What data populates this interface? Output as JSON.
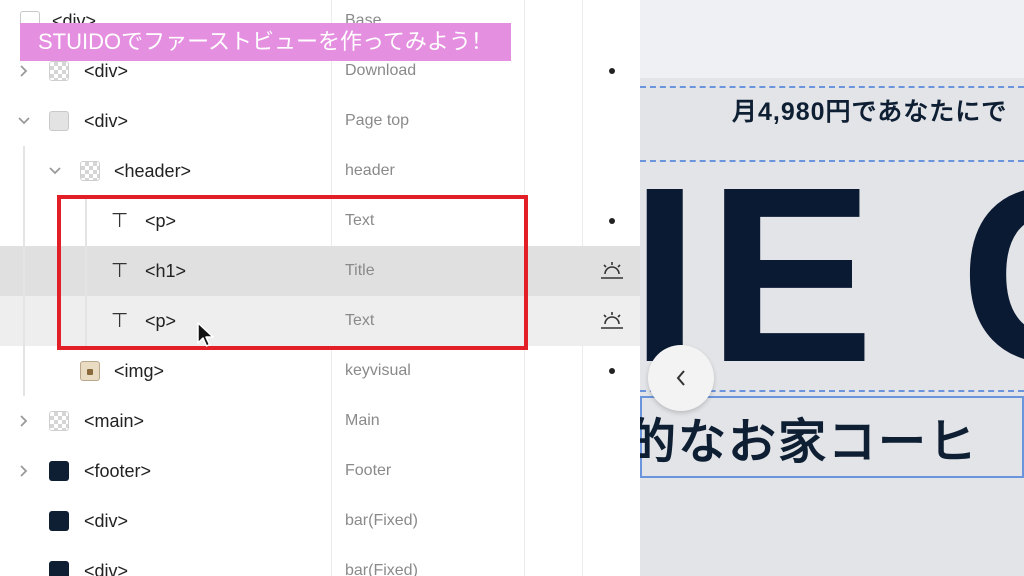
{
  "caption": "STUIDOでファーストビューを作ってみよう！",
  "layers": [
    {
      "tag": "<div>",
      "name": "Base",
      "icon": "square-outline-icon"
    },
    {
      "tag": "<div>",
      "name": "Download",
      "icon": "checker-box-icon"
    },
    {
      "tag": "<div>",
      "name": "Page top",
      "icon": "gray-box-icon"
    },
    {
      "tag": "<header>",
      "name": "header",
      "icon": "checker-box-icon"
    },
    {
      "tag": "<p>",
      "name": "Text",
      "icon": "text-icon"
    },
    {
      "tag": "<h1>",
      "name": "Title",
      "icon": "text-icon",
      "state": "selected"
    },
    {
      "tag": "<p>",
      "name": "Text",
      "icon": "text-icon",
      "state": "hover"
    },
    {
      "tag": "<img>",
      "name": "keyvisual",
      "icon": "image-icon"
    },
    {
      "tag": "<main>",
      "name": "Main",
      "icon": "checker-box-icon"
    },
    {
      "tag": "<footer>",
      "name": "Footer",
      "icon": "navy-box-icon"
    },
    {
      "tag": "<div>",
      "name": "bar(Fixed)",
      "icon": "navy-box-icon"
    },
    {
      "tag": "<div>",
      "name": "bar(Fixed)",
      "icon": "navy-box-icon"
    }
  ],
  "text_icon_glyph": "⊤",
  "preview": {
    "offer": "月4,980円であなたにで",
    "title": "IE C",
    "subtitle": "的なお家コーヒ"
  },
  "colors": {
    "highlight": "#e21e26",
    "caption_bg": "#e58fe0",
    "selection_dash": "#6a95dc",
    "navy": "#0f1f33"
  }
}
